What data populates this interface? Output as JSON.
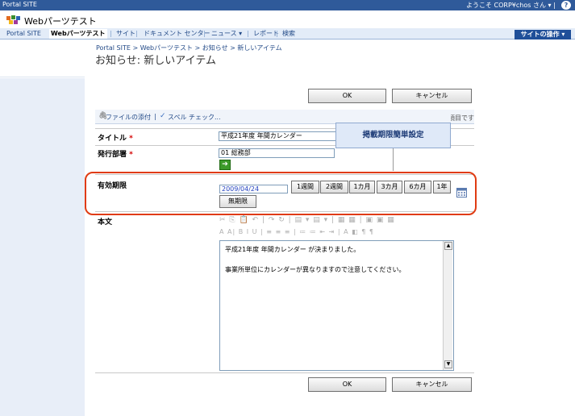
{
  "topbar": {
    "site": "Portal SITE",
    "welcome": "ようこそ CORP¥chos さん ▾ |",
    "help": "?"
  },
  "site_title": "Webパーツテスト",
  "tabs": [
    "Portal SITE",
    "Webパーツテスト",
    "サイト",
    "ドキュメント センター",
    "ニュース ▾",
    "レポート",
    "検索"
  ],
  "site_actions": "サイトの操作 ▾",
  "breadcrumb": "Portal SITE > Webパーツテスト > お知らせ > 新しいアイテム",
  "page_title": "お知らせ: 新しいアイテム",
  "buttons": {
    "ok": "OK",
    "cancel": "キャンセル"
  },
  "toolbar": {
    "attach": "ファイルの添付",
    "separator": "|",
    "spell": "スペル チェック...",
    "required_note": "必須項目です"
  },
  "fields": {
    "title": {
      "label": "タイトル",
      "value": "平成21年度 年間カレンダー"
    },
    "dept": {
      "label": "発行部署",
      "value": "01 総務部"
    },
    "expires": {
      "label": "有効期限",
      "value": "2009/04/24"
    },
    "body": {
      "label": "本文"
    },
    "required_mark": "*"
  },
  "period_buttons": [
    "1週間",
    "2週間",
    "1カ月",
    "3カ月",
    "6カ月",
    "1年"
  ],
  "no_limit": "無期限",
  "tooltip": "掲載期限簡単設定",
  "body_text": {
    "line1": "平成21年度 年間カレンダー が決まりました。",
    "line2": "事業所単位にカレンダーが異なりますので注意してください。"
  },
  "rte_toolbar_row2": "A A| B I U | ≡ ≡ ≡ | ≔ ≔ ⇤ ⇥ | A ◧ ¶ ¶"
}
